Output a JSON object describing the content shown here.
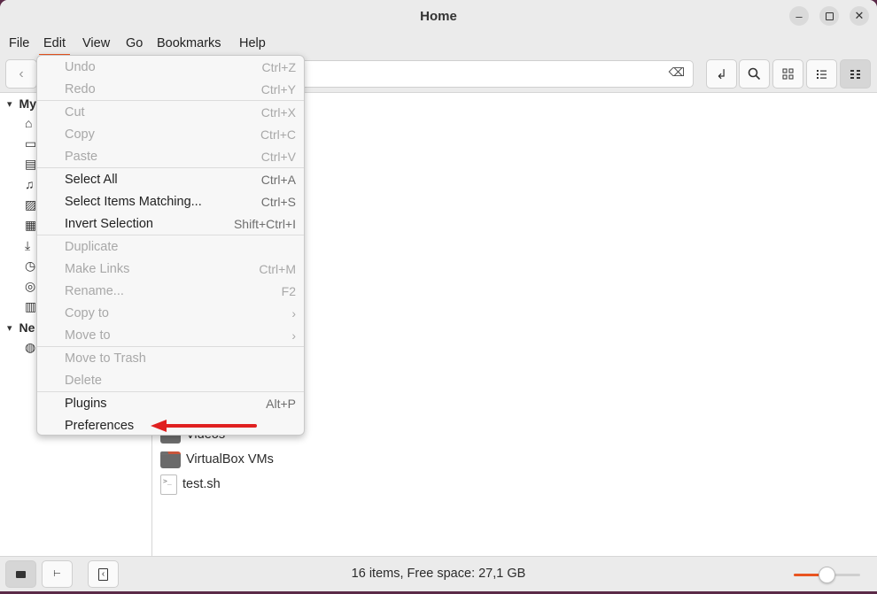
{
  "window": {
    "title": "Home"
  },
  "menubar": {
    "file": "File",
    "edit": "Edit",
    "view": "View",
    "go": "Go",
    "bookmarks": "Bookmarks",
    "help": "Help"
  },
  "sidebar": {
    "places_header": "My",
    "network_header": "Ne"
  },
  "files": [
    {
      "name": "Videos",
      "icon": "folder-icon"
    },
    {
      "name": "VirtualBox VMs",
      "icon": "folder-icon"
    },
    {
      "name": "test.sh",
      "icon": "script-file-icon",
      "glyph": ">_"
    }
  ],
  "edit_menu": {
    "undo": {
      "label": "Undo",
      "accel": "Ctrl+Z"
    },
    "redo": {
      "label": "Redo",
      "accel": "Ctrl+Y"
    },
    "cut": {
      "label": "Cut",
      "accel": "Ctrl+X"
    },
    "copy": {
      "label": "Copy",
      "accel": "Ctrl+C"
    },
    "paste": {
      "label": "Paste",
      "accel": "Ctrl+V"
    },
    "select_all": {
      "label": "Select All",
      "accel": "Ctrl+A"
    },
    "select_matching": {
      "label": "Select Items Matching...",
      "accel": "Ctrl+S"
    },
    "invert": {
      "label": "Invert Selection",
      "accel": "Shift+Ctrl+I"
    },
    "duplicate": {
      "label": "Duplicate"
    },
    "make_links": {
      "label": "Make Links",
      "accel": "Ctrl+M"
    },
    "rename": {
      "label": "Rename...",
      "accel": "F2"
    },
    "copy_to": {
      "label": "Copy to",
      "accel": "›"
    },
    "move_to": {
      "label": "Move to",
      "accel": "›"
    },
    "move_trash": {
      "label": "Move to Trash"
    },
    "delete": {
      "label": "Delete"
    },
    "plugins": {
      "label": "Plugins",
      "accel": "Alt+P"
    },
    "preferences": {
      "label": "Preferences"
    }
  },
  "statusbar": {
    "text": "16 items, Free space: 27,1 GB",
    "zoom_level": 0.5
  },
  "colors": {
    "accent": "#e95420",
    "annotation_arrow": "#e02020"
  }
}
